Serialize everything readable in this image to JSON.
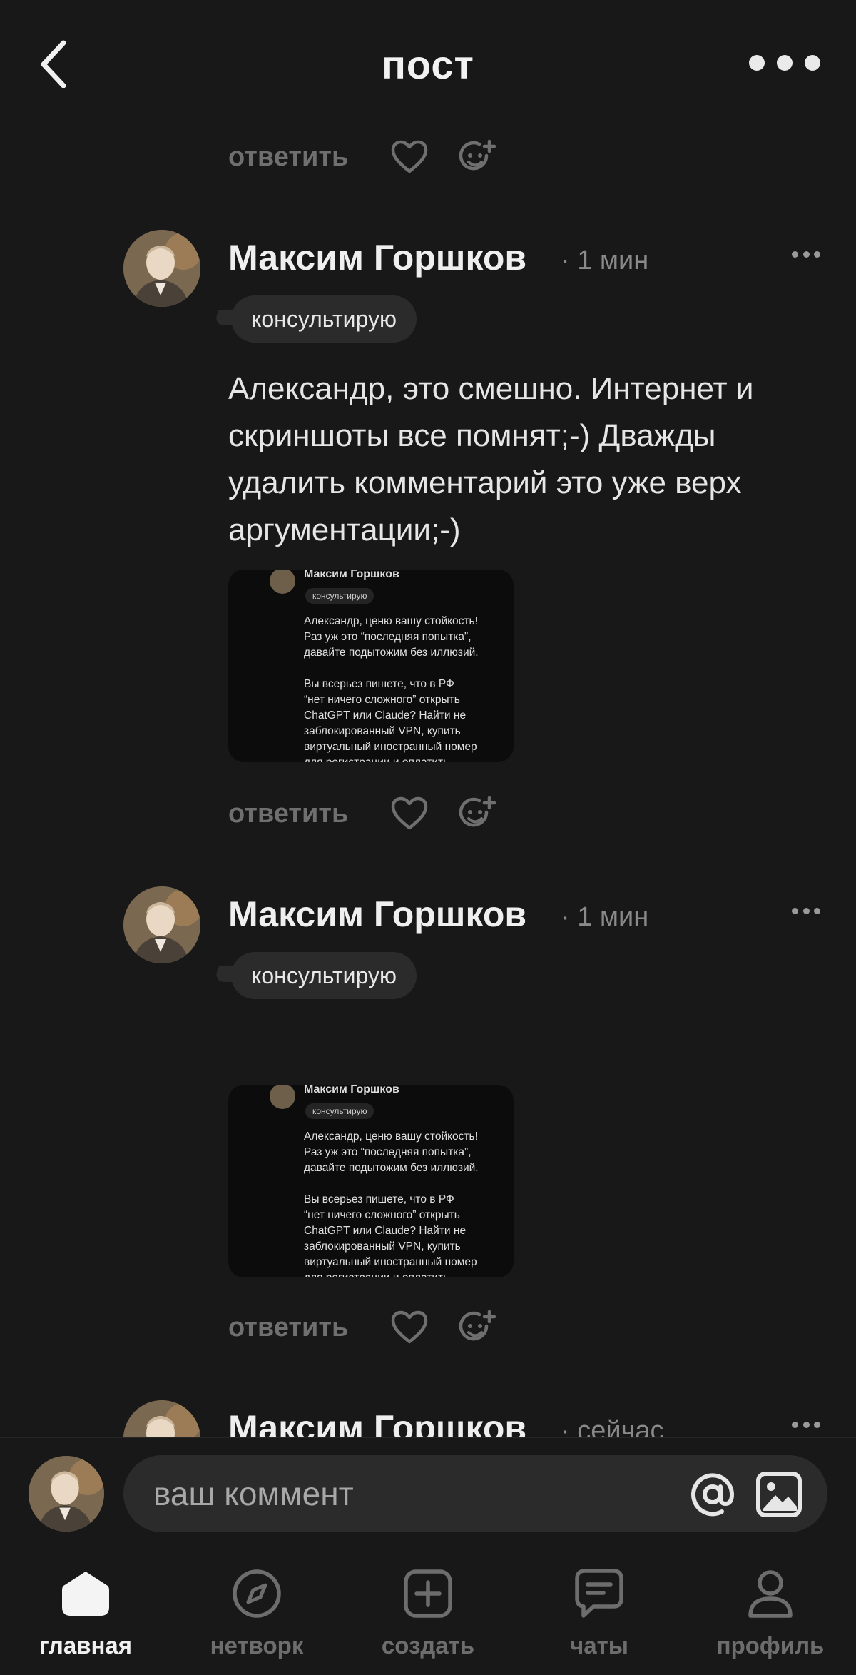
{
  "header": {
    "title": "пост"
  },
  "actions": {
    "reply_label": "ответить"
  },
  "comments": [
    {
      "author": "Максим Горшков",
      "time": "· 1 мин",
      "badge": "консультирую",
      "text": "Александр, это смешно. Интернет и скриншоты все помнят;-) Дважды удалить комментарий это уже верх аргументации;-)",
      "attachment": {
        "author": "Максим Горшков",
        "badge": "консультирую",
        "text": "Александр, ценю вашу стойкость!\nРаз уж это “последняя попытка”,\nдавайте подытожим без иллюзий.\n\nВы всерьез пишете, что в РФ\n“нет ничего сложного” открыть\nChatGPT или Claude? Найти не\nзаблокированный VPN, купить\nвиртуальный иностранный номер\nдля регистрации и оплатить"
      }
    },
    {
      "author": "Максим Горшков",
      "time": "· 1 мин",
      "badge": "консультирую",
      "attachment": {
        "author": "Максим Горшков",
        "badge": "консультирую",
        "text": "Александр, ценю вашу стойкость!\nРаз уж это “последняя попытка”,\nдавайте подытожим без иллюзий.\n\nВы всерьез пишете, что в РФ\n“нет ничего сложного” открыть\nChatGPT или Claude? Найти не\nзаблокированный VPN, купить\nвиртуальный иностранный номер\nдля регистрации и оплатить"
      }
    },
    {
      "author": "Максим Горшков",
      "time": "· сейчас"
    }
  ],
  "composer": {
    "placeholder": "ваш коммент"
  },
  "nav": [
    {
      "label": "главная",
      "icon": "home-icon",
      "active": true
    },
    {
      "label": "нетворк",
      "icon": "compass-icon"
    },
    {
      "label": "создать",
      "icon": "plus-square-icon"
    },
    {
      "label": "чаты",
      "icon": "chat-icon"
    },
    {
      "label": "профиль",
      "icon": "user-icon"
    }
  ],
  "colors": {
    "background": "#181818",
    "pill": "#2b2b2b",
    "muted": "#6f6f6f",
    "text": "#ececec"
  }
}
